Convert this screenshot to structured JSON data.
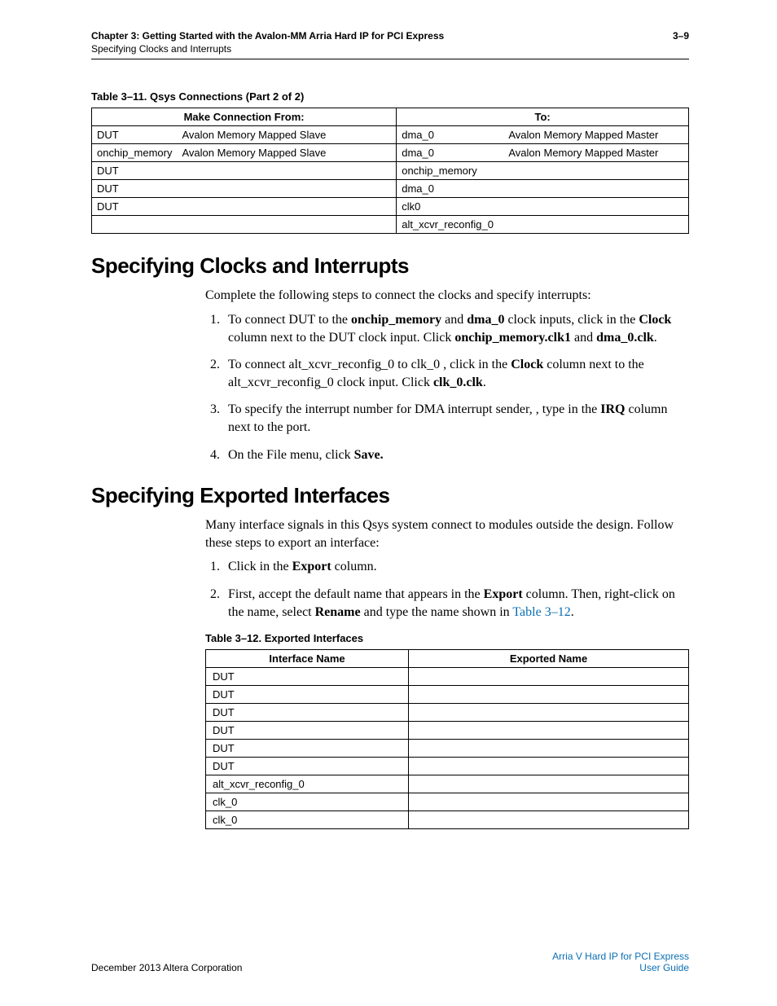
{
  "header": {
    "left_line1": "Chapter 3:  Getting Started with the Avalon-MM Arria Hard IP for PCI Express",
    "left_line2": "Specifying Clocks and Interrupts",
    "right": "3–9"
  },
  "table311": {
    "caption": "Table 3–11.  Qsys Connections   (Part 2 of 2)",
    "head_from": "Make Connection From:",
    "head_to": "To:",
    "rows": [
      {
        "f1": "DUT",
        "f2": "Avalon Memory Mapped Slave",
        "t1": "dma_0",
        "t2": "Avalon Memory Mapped Master"
      },
      {
        "f1": "onchip_memory",
        "f2": "Avalon Memory Mapped Slave",
        "t1": "dma_0",
        "t2": "Avalon Memory Mapped Master"
      },
      {
        "f1": "DUT",
        "f2": "",
        "t1": "onchip_memory",
        "t2": ""
      },
      {
        "f1": "DUT",
        "f2": "",
        "t1": "dma_0",
        "t2": ""
      },
      {
        "f1": "DUT",
        "f2": "",
        "t1": "clk0",
        "t2": ""
      },
      {
        "f1": "",
        "f2": "",
        "t1": "alt_xcvr_reconfig_0",
        "t2": ""
      }
    ]
  },
  "section1": {
    "title": "Specifying Clocks and Interrupts",
    "intro": "Complete the following steps to connect the clocks and specify interrupts:",
    "s1a": "To connect DUT ",
    "s1b": " to the ",
    "s1c": "onchip_memory",
    "s1d": " and ",
    "s1e": "dma_0",
    "s1f": " clock inputs, click in the ",
    "s1g": "Clock",
    "s1h": " column next to the DUT ",
    "s1i": " clock input. Click ",
    "s1j": "onchip_memory.clk1",
    "s1k": " and ",
    "s1l": "dma_0.clk",
    "s1m": ".",
    "s2a": "To connect alt_xcvr_reconfig_0 ",
    "s2b": " to clk_0 ",
    "s2c": ", click in the ",
    "s2d": "Clock",
    "s2e": " column next to the alt_xcvr_reconfig_0 ",
    "s2f": " clock input. Click ",
    "s2g": "clk_0.clk",
    "s2h": ".",
    "s3a": "To specify the interrupt number for DMA interrupt sender, ",
    "s3b": ", type ",
    "s3c": " in the ",
    "s3d": "IRQ",
    "s3e": " column next to the ",
    "s3f": " port.",
    "s4a": "On the File menu, click ",
    "s4b": "Save.",
    "gap1": "                     ",
    "gap2": "                 ",
    "gap3": "                           ",
    "gap4": "                       ",
    "gap5": "                                               ",
    "gap6": "     ",
    "gap7": "   ",
    "gap8": "       "
  },
  "section2": {
    "title": "Specifying Exported Interfaces",
    "p1": "Many interface signals in this Qsys system connect to modules outside the design. Follow these steps to export an interface:",
    "l1a": "Click in the ",
    "l1b": "Export",
    "l1c": " column.",
    "l2a": "First, accept the default name that appears in the ",
    "l2b": "Export",
    "l2c": " column. Then, right-click on the name, select ",
    "l2d": "Rename",
    "l2e": " and type the name shown in ",
    "l2f": "Table 3–12",
    "l2g": "."
  },
  "table312": {
    "caption": "Table 3–12.  Exported Interfaces",
    "h1": "Interface Name",
    "h2": "Exported Name",
    "rows": [
      {
        "n": "DUT",
        "e": ""
      },
      {
        "n": "DUT",
        "e": ""
      },
      {
        "n": "DUT",
        "e": ""
      },
      {
        "n": "DUT",
        "e": ""
      },
      {
        "n": "DUT",
        "e": ""
      },
      {
        "n": "DUT",
        "e": ""
      },
      {
        "n": "alt_xcvr_reconfig_0",
        "e": ""
      },
      {
        "n": "clk_0",
        "e": ""
      },
      {
        "n": "clk_0",
        "e": ""
      }
    ]
  },
  "footer": {
    "left": "December 2013    Altera Corporation",
    "right1": "Arria V Hard IP for PCI Express",
    "right2": "User Guide"
  }
}
